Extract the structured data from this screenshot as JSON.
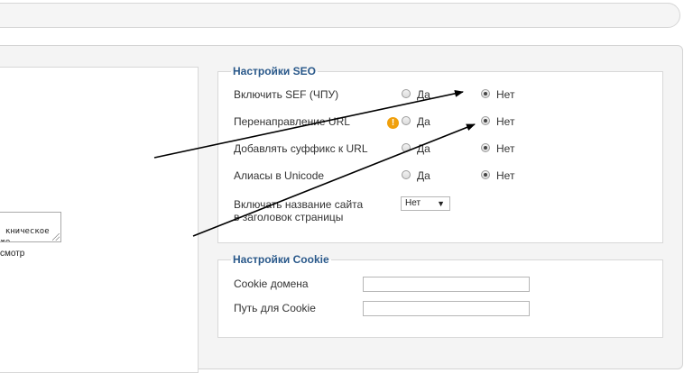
{
  "left": {
    "textarea_text": "кническое\nюже.",
    "note": "смотр"
  },
  "seo": {
    "legend": "Настройки SEO",
    "rows": [
      {
        "label": "Включить SEF (ЧПУ)",
        "yes": "Да",
        "no": "Нет",
        "selected": "no",
        "warning": false
      },
      {
        "label": "Перенаправление URL",
        "yes": "Да",
        "no": "Нет",
        "selected": "no",
        "warning": true
      },
      {
        "label": "Добавлять суффикс к URL",
        "yes": "Да",
        "no": "Нет",
        "selected": "no",
        "warning": false
      },
      {
        "label": "Алиасы в Unicode",
        "yes": "Да",
        "no": "Нет",
        "selected": "no",
        "warning": false
      }
    ],
    "site_name": {
      "label_line1": "Включать название сайта",
      "label_line2": "в заголовок страницы",
      "value": "Нет"
    }
  },
  "cookie": {
    "legend": "Настройки Cookie",
    "domain_label": "Cookie домена",
    "domain_value": "",
    "path_label": "Путь для Cookie",
    "path_value": ""
  },
  "icons": {
    "warning": "warning-icon",
    "caret": "chevron-down-icon"
  }
}
